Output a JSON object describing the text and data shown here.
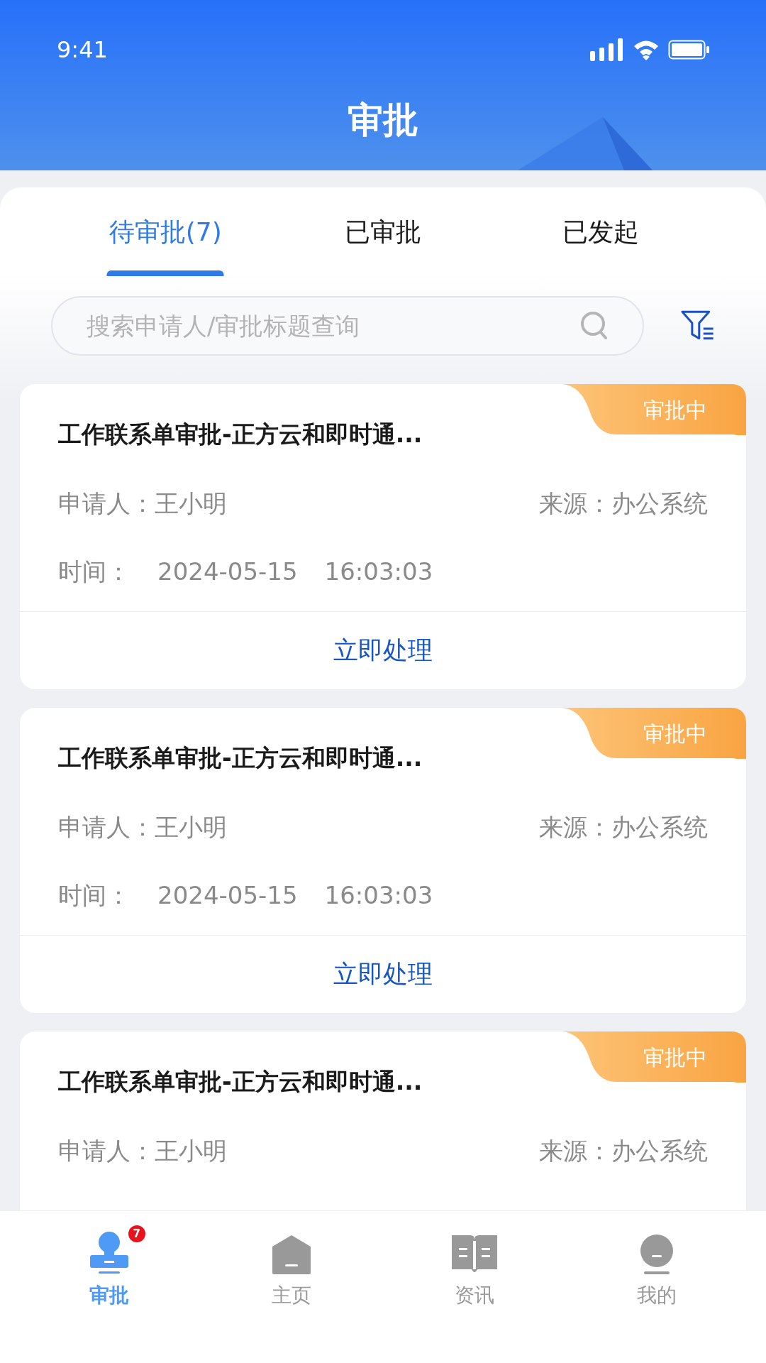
{
  "status_bar": {
    "time": "9:41"
  },
  "header": {
    "title": "审批"
  },
  "tabs": [
    {
      "label": "待审批(7)",
      "selected": true
    },
    {
      "label": "已审批",
      "selected": false
    },
    {
      "label": "已发起",
      "selected": false
    }
  ],
  "search": {
    "placeholder": "搜索申请人/审批标题查询"
  },
  "cards": [
    {
      "title": "工作联系单审批-正方云和即时通...",
      "status": "审批中",
      "applicant_label": "申请人：",
      "applicant": "王小明",
      "source_label": "来源：",
      "source": "办公系统",
      "time_label": "时间：",
      "date": "2024-05-15",
      "time": "16:03:03",
      "action": "立即处理"
    },
    {
      "title": "工作联系单审批-正方云和即时通...",
      "status": "审批中",
      "applicant_label": "申请人：",
      "applicant": "王小明",
      "source_label": "来源：",
      "source": "办公系统",
      "time_label": "时间：",
      "date": "2024-05-15",
      "time": "16:03:03",
      "action": "立即处理"
    },
    {
      "title": "工作联系单审批-正方云和即时通...",
      "status": "审批中",
      "applicant_label": "申请人：",
      "applicant": "王小明",
      "source_label": "来源：",
      "source": "办公系统"
    }
  ],
  "nav": [
    {
      "kind": "stamp",
      "label": "审批",
      "selected": true,
      "badge": "7"
    },
    {
      "kind": "home",
      "label": "主页",
      "selected": false
    },
    {
      "kind": "book",
      "label": "资讯",
      "selected": false
    },
    {
      "kind": "user",
      "label": "我的",
      "selected": false
    }
  ]
}
